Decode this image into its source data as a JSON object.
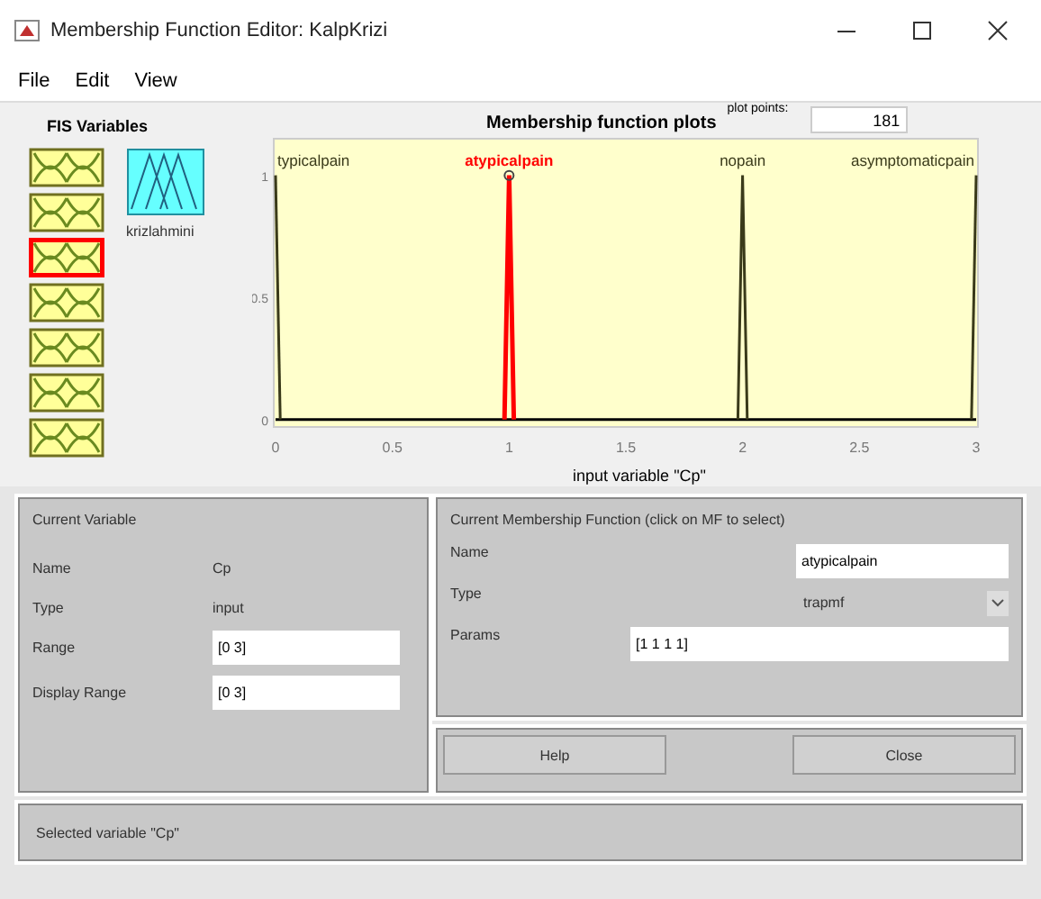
{
  "window": {
    "title": "Membership Function Editor: KalpKrizi"
  },
  "menu": [
    "File",
    "Edit",
    "View"
  ],
  "fis_variables": {
    "title": "FIS Variables",
    "inputs": [
      {
        "selected": false
      },
      {
        "selected": false
      },
      {
        "selected": true
      },
      {
        "selected": false
      },
      {
        "selected": false
      },
      {
        "selected": false
      },
      {
        "selected": false
      }
    ],
    "outputs": [
      {
        "label": "krizlahmini",
        "selected": false
      }
    ]
  },
  "plot": {
    "title": "Membership function plots",
    "plot_points_label": "plot points:",
    "plot_points": "181",
    "xlabel_text": "input variable \"Cp\"",
    "chart_data": {
      "type": "line",
      "x": [
        0,
        0.02,
        0.98,
        1,
        1.02,
        1.98,
        2,
        2.02,
        2.98,
        3
      ],
      "xlim": [
        0,
        3
      ],
      "ylim": [
        -0.03,
        1.15
      ],
      "xticks": [
        0,
        0.5,
        1,
        1.5,
        2,
        2.5,
        3
      ],
      "yticks": [
        0,
        0.5,
        1
      ],
      "series": [
        {
          "name": "typicalpain",
          "color": "#3a3a1a",
          "values": [
            1,
            0,
            null,
            null,
            null,
            null,
            null,
            null,
            null,
            null
          ]
        },
        {
          "name": "atypicalpain",
          "color": "#ff0000",
          "values": [
            null,
            null,
            0,
            1,
            0,
            null,
            null,
            null,
            null,
            null
          ]
        },
        {
          "name": "nopain",
          "color": "#3a3a1a",
          "values": [
            null,
            null,
            null,
            null,
            null,
            0,
            1,
            0,
            null,
            null
          ]
        },
        {
          "name": "asymptomaticpain",
          "color": "#3a3a1a",
          "values": [
            null,
            null,
            null,
            null,
            null,
            null,
            null,
            null,
            0,
            1
          ]
        }
      ]
    }
  },
  "current_variable": {
    "title": "Current Variable",
    "name_label": "Name",
    "name": "Cp",
    "type_label": "Type",
    "type": "input",
    "range_label": "Range",
    "range": "[0 3]",
    "display_range_label": "Display Range",
    "display_range": "[0 3]"
  },
  "current_mf": {
    "title": "Current Membership Function (click on MF to select)",
    "name_label": "Name",
    "name": "atypicalpain",
    "type_label": "Type",
    "type": "trapmf",
    "params_label": "Params",
    "params": "[1 1 1 1]"
  },
  "buttons": [
    "Help",
    "Close"
  ],
  "status": "Selected variable \"Cp\""
}
